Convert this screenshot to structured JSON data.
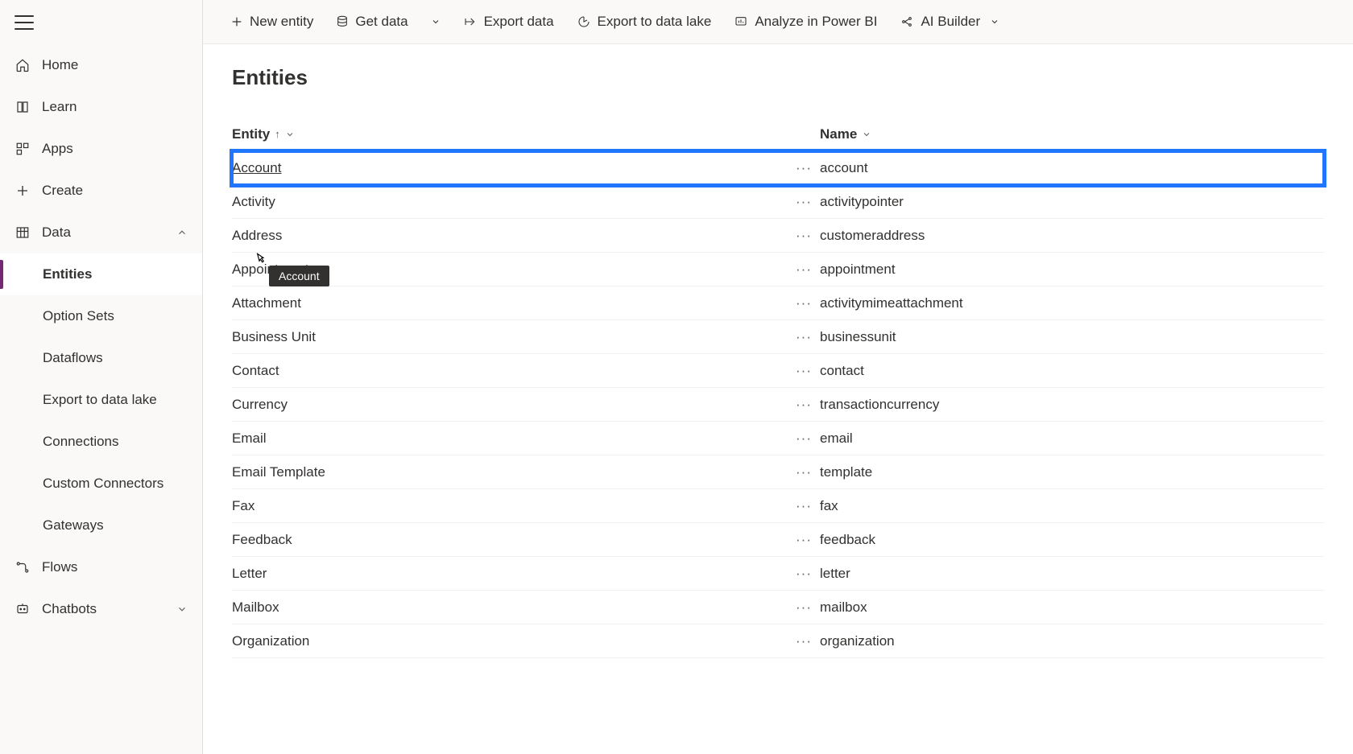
{
  "sidebar": {
    "items": [
      {
        "label": "Home"
      },
      {
        "label": "Learn"
      },
      {
        "label": "Apps"
      },
      {
        "label": "Create"
      },
      {
        "label": "Data"
      },
      {
        "label": "Flows"
      },
      {
        "label": "Chatbots"
      }
    ],
    "data_sub": [
      {
        "label": "Entities"
      },
      {
        "label": "Option Sets"
      },
      {
        "label": "Dataflows"
      },
      {
        "label": "Export to data lake"
      },
      {
        "label": "Connections"
      },
      {
        "label": "Custom Connectors"
      },
      {
        "label": "Gateways"
      }
    ]
  },
  "cmdbar": {
    "new_entity": "New entity",
    "get_data": "Get data",
    "export_data": "Export data",
    "export_lake": "Export to data lake",
    "analyze": "Analyze in Power BI",
    "ai_builder": "AI Builder"
  },
  "page": {
    "title": "Entities",
    "columns": {
      "entity": "Entity",
      "name": "Name"
    },
    "tooltip": "Account"
  },
  "entities": [
    {
      "entity": "Account",
      "name": "account"
    },
    {
      "entity": "Activity",
      "name": "activitypointer"
    },
    {
      "entity": "Address",
      "name": "customeraddress"
    },
    {
      "entity": "Appointment",
      "name": "appointment"
    },
    {
      "entity": "Attachment",
      "name": "activitymimeattachment"
    },
    {
      "entity": "Business Unit",
      "name": "businessunit"
    },
    {
      "entity": "Contact",
      "name": "contact"
    },
    {
      "entity": "Currency",
      "name": "transactioncurrency"
    },
    {
      "entity": "Email",
      "name": "email"
    },
    {
      "entity": "Email Template",
      "name": "template"
    },
    {
      "entity": "Fax",
      "name": "fax"
    },
    {
      "entity": "Feedback",
      "name": "feedback"
    },
    {
      "entity": "Letter",
      "name": "letter"
    },
    {
      "entity": "Mailbox",
      "name": "mailbox"
    },
    {
      "entity": "Organization",
      "name": "organization"
    }
  ]
}
